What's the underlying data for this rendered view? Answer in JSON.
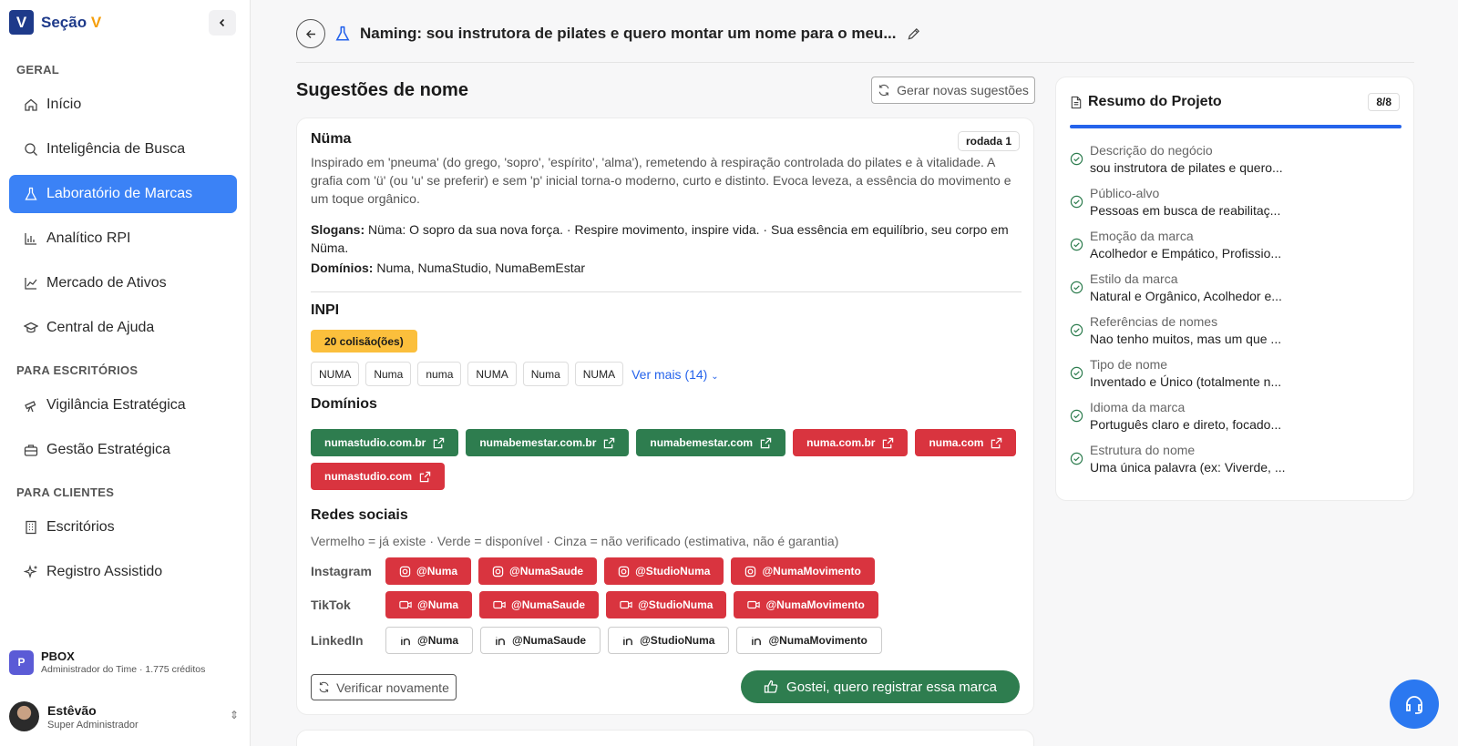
{
  "brand": {
    "mark": "V",
    "name": "Seção",
    "name_accent": "V"
  },
  "sidebar": {
    "sections": [
      "GERAL",
      "PARA ESCRITÓRIOS",
      "PARA CLIENTES"
    ],
    "items": [
      {
        "label": "Início"
      },
      {
        "label": "Inteligência de Busca"
      },
      {
        "label": "Laboratório de Marcas",
        "active": true
      },
      {
        "label": "Analítico RPI"
      },
      {
        "label": "Mercado de Ativos"
      },
      {
        "label": "Central de Ajuda"
      },
      {
        "label": "Vigilância Estratégica"
      },
      {
        "label": "Gestão Estratégica"
      },
      {
        "label": "Escritórios"
      },
      {
        "label": "Registro Assistido"
      }
    ],
    "org": {
      "initial": "P",
      "name": "PBOX",
      "subtitle": "Administrador do Time · 1.775 créditos"
    },
    "user": {
      "name": "Estêvão",
      "role": "Super Administrador"
    }
  },
  "header": {
    "title": "Naming: sou instrutora de pilates e quero montar um nome para o meu..."
  },
  "main": {
    "section_title": "Sugestões de nome",
    "regen_label": "Gerar novas sugestões",
    "suggestion": {
      "name": "Nüma",
      "round": "rodada 1",
      "description": "Inspirado em 'pneuma' (do grego, 'sopro', 'espírito', 'alma'), remetendo à respiração controlada do pilates e à vitalidade. A grafia com 'ü' (ou 'u' se preferir) e sem 'p' inicial torna-o moderno, curto e distinto. Evoca leveza, a essência do movimento e um toque orgânico.",
      "slogans_label": "Slogans:",
      "slogans": "Nüma: O sopro da sua nova força. · Respire movimento, inspire vida. · Sua essência em equilíbrio, seu corpo em Nüma.",
      "domains_label": "Domínios:",
      "domains_text": "Numa, NumaStudio, NumaBemEstar",
      "inpi": {
        "title": "INPI",
        "collisions": "20 colisão(ões)",
        "chips": [
          "NUMA",
          "Numa",
          "numa",
          "NUMA",
          "Numa",
          "NUMA"
        ],
        "see_more": "Ver mais (14)"
      },
      "domains": {
        "title": "Domínios",
        "items": [
          {
            "label": "numastudio.com.br",
            "status": "available"
          },
          {
            "label": "numabemestar.com.br",
            "status": "available"
          },
          {
            "label": "numabemestar.com",
            "status": "available"
          },
          {
            "label": "numa.com.br",
            "status": "taken"
          },
          {
            "label": "numa.com",
            "status": "taken"
          },
          {
            "label": "numastudio.com",
            "status": "taken"
          }
        ]
      },
      "social": {
        "title": "Redes sociais",
        "legend": "Vermelho = já existe · Verde = disponível · Cinza = não verificado (estimativa, não é garantia)",
        "networks": [
          {
            "name": "Instagram",
            "handles": [
              "@Numa",
              "@NumaSaude",
              "@StudioNuma",
              "@NumaMovimento"
            ]
          },
          {
            "name": "TikTok",
            "handles": [
              "@Numa",
              "@NumaSaude",
              "@StudioNuma",
              "@NumaMovimento"
            ]
          },
          {
            "name": "LinkedIn",
            "handles": [
              "@Numa",
              "@NumaSaude",
              "@StudioNuma",
              "@NumaMovimento"
            ]
          }
        ]
      },
      "verify_label": "Verificar novamente",
      "like_label": "Gostei, quero registrar essa marca"
    }
  },
  "summary": {
    "title": "Resumo do Projeto",
    "count": "8/8",
    "progress": 1.0,
    "items": [
      {
        "label": "Descrição do negócio",
        "value": "sou instrutora de pilates e quero..."
      },
      {
        "label": "Público-alvo",
        "value": "Pessoas em busca de reabilitaç..."
      },
      {
        "label": "Emoção da marca",
        "value": "Acolhedor e Empático, Profissio..."
      },
      {
        "label": "Estilo da marca",
        "value": "Natural e Orgânico, Acolhedor e..."
      },
      {
        "label": "Referências de nomes",
        "value": "Nao tenho muitos, mas um que ..."
      },
      {
        "label": "Tipo de nome",
        "value": "Inventado e Único (totalmente n..."
      },
      {
        "label": "Idioma da marca",
        "value": "Português claro e direto, focado..."
      },
      {
        "label": "Estrutura do nome",
        "value": "Uma única palavra (ex: Viverde, ..."
      }
    ]
  },
  "colors": {
    "accent": "#3b82f6",
    "brand": "#1e3a8a",
    "available": "#2e7d4f",
    "taken": "#d9343f",
    "warning": "#fbbf3c"
  }
}
